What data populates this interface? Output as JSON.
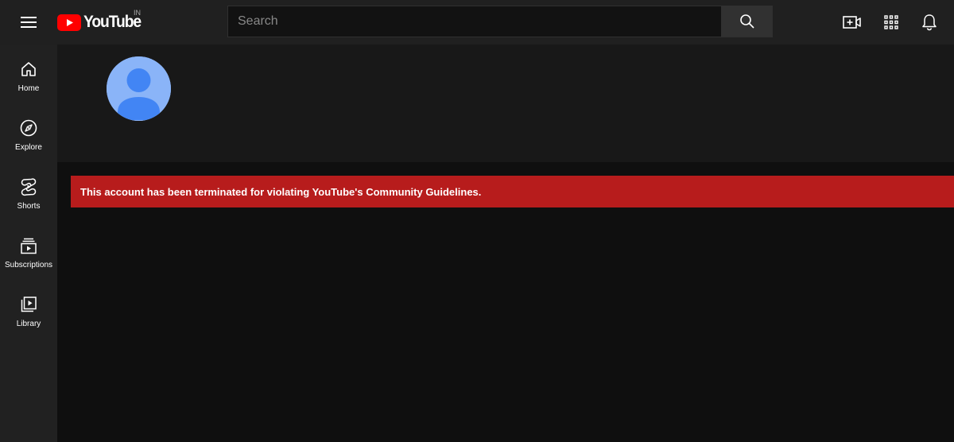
{
  "header": {
    "logo_text": "YouTube",
    "country_code": "IN",
    "search_placeholder": "Search",
    "icons": [
      "menu-icon",
      "youtube-play-icon",
      "search-icon",
      "create-video-icon",
      "apps-grid-icon",
      "bell-icon"
    ]
  },
  "guide": {
    "items": [
      {
        "label": "Home",
        "icon": "home-icon"
      },
      {
        "label": "Explore",
        "icon": "compass-icon"
      },
      {
        "label": "Shorts",
        "icon": "shorts-icon"
      },
      {
        "label": "Subscriptions",
        "icon": "subscriptions-icon"
      },
      {
        "label": "Library",
        "icon": "library-icon"
      }
    ]
  },
  "channel": {
    "avatar_icon": "default-avatar-icon"
  },
  "banner": {
    "message": "This account has been terminated for violating YouTube's Community Guidelines."
  },
  "colors": {
    "brand_red": "#ff0000",
    "banner_red": "#b71c1c",
    "avatar_bg": "#8ab4f8",
    "avatar_fg": "#4285f4"
  }
}
